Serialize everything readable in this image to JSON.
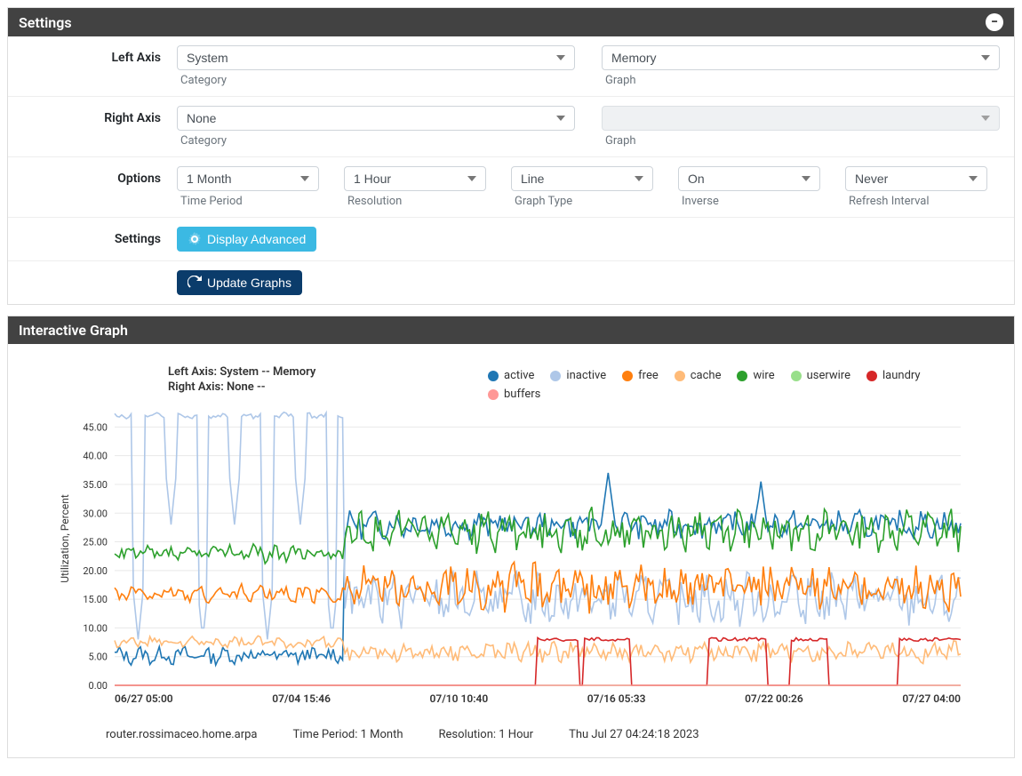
{
  "settings": {
    "title": "Settings",
    "rows": {
      "left_axis": {
        "label": "Left Axis",
        "category": {
          "value": "System",
          "help": "Category"
        },
        "graph": {
          "value": "Memory",
          "help": "Graph"
        }
      },
      "right_axis": {
        "label": "Right Axis",
        "category": {
          "value": "None",
          "help": "Category"
        },
        "graph": {
          "value": "",
          "help": "Graph",
          "disabled": true
        }
      },
      "options": {
        "label": "Options",
        "time_period": {
          "value": "1 Month",
          "help": "Time Period"
        },
        "resolution": {
          "value": "1 Hour",
          "help": "Resolution"
        },
        "graph_type": {
          "value": "Line",
          "help": "Graph Type"
        },
        "inverse": {
          "value": "On",
          "help": "Inverse"
        },
        "refresh": {
          "value": "Never",
          "help": "Refresh Interval"
        }
      },
      "settings_row": {
        "label": "Settings",
        "display_advanced": "Display Advanced"
      },
      "update": {
        "label": "Update Graphs"
      }
    }
  },
  "graph_panel": {
    "title": "Interactive Graph",
    "left_title": "Left Axis: System -- Memory",
    "right_title": "Right Axis: None --",
    "ylabel": "Utilization, Percent",
    "footer": {
      "host": "router.rossimaceo.home.arpa",
      "time_period": "Time Period: 1 Month",
      "resolution": "Resolution: 1 Hour",
      "timestamp": "Thu Jul 27 04:24:18 2023"
    }
  },
  "chart_data": {
    "type": "line",
    "ylabel": "Utilization, Percent",
    "ylim": [
      0,
      48
    ],
    "yticks": [
      0.0,
      5.0,
      10.0,
      15.0,
      20.0,
      25.0,
      30.0,
      35.0,
      40.0,
      45.0
    ],
    "x_range": [
      0,
      720
    ],
    "xticks": [
      "06/27 05:00",
      "07/04 15:46",
      "07/10 10:40",
      "07/16 05:33",
      "07/22 00:26",
      "07/27 04:00"
    ],
    "legend": [
      {
        "name": "active",
        "color": "#1f77b4"
      },
      {
        "name": "inactive",
        "color": "#aec7e8"
      },
      {
        "name": "free",
        "color": "#ff7f0e"
      },
      {
        "name": "cache",
        "color": "#ffbb78"
      },
      {
        "name": "wire",
        "color": "#2ca02c"
      },
      {
        "name": "userwire",
        "color": "#98df8a"
      },
      {
        "name": "laundry",
        "color": "#d62728"
      },
      {
        "name": "buffers",
        "color": "#ff9896"
      }
    ],
    "series": [
      {
        "name": "active",
        "color": "#1f77b4",
        "base": 5.2,
        "base2": 28,
        "transition": 195,
        "amp": 1.2,
        "amp2": 1.8,
        "spikes": [
          [
            420,
            37
          ],
          [
            550,
            35.5
          ]
        ]
      },
      {
        "name": "inactive",
        "color": "#aec7e8",
        "base": 47,
        "base2": 15,
        "transition": 195,
        "amp": 0.4,
        "amp2": 3.5,
        "dips": [
          [
            20,
            8
          ],
          [
            48,
            28
          ],
          [
            75,
            8
          ],
          [
            102,
            28
          ],
          [
            130,
            8
          ],
          [
            158,
            28
          ],
          [
            185,
            8
          ],
          [
            345,
            20
          ],
          [
            430,
            22
          ],
          [
            555,
            21
          ]
        ]
      },
      {
        "name": "free",
        "color": "#ff7f0e",
        "base": 16,
        "base2": 17,
        "transition": 195,
        "amp": 1.2,
        "amp2": 3.2
      },
      {
        "name": "cache",
        "color": "#ffbb78",
        "base": 7.5,
        "base2": 5.8,
        "transition": 195,
        "amp": 0.8,
        "amp2": 1.4
      },
      {
        "name": "wire",
        "color": "#2ca02c",
        "base": 23,
        "base2": 27,
        "transition": 195,
        "amp": 1.2,
        "amp2": 2.8
      },
      {
        "name": "userwire",
        "color": "#98df8a",
        "base": 0,
        "base2": 0,
        "transition": 195,
        "amp": 0,
        "amp2": 0
      },
      {
        "name": "laundry",
        "color": "#d62728",
        "base": 0,
        "base2": 0,
        "transition": 195,
        "amp": 0,
        "amp2": 0,
        "steps": [
          [
            360,
            8
          ],
          [
            395,
            0
          ],
          [
            400,
            8
          ],
          [
            440,
            0
          ],
          [
            505,
            8
          ],
          [
            555,
            0
          ],
          [
            575,
            8
          ],
          [
            608,
            0
          ],
          [
            668,
            8
          ]
        ]
      },
      {
        "name": "buffers",
        "color": "#ff9896",
        "base": 0,
        "base2": 0,
        "transition": 195,
        "amp": 0,
        "amp2": 0
      }
    ]
  }
}
